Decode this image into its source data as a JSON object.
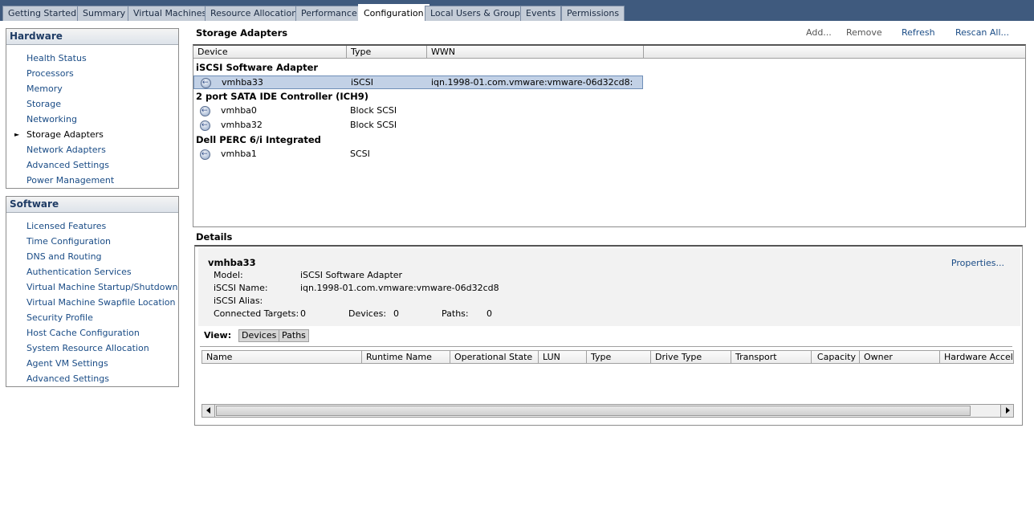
{
  "tabs": [
    {
      "label": "Getting Started"
    },
    {
      "label": "Summary"
    },
    {
      "label": "Virtual Machines"
    },
    {
      "label": "Resource Allocation"
    },
    {
      "label": "Performance"
    },
    {
      "label": "Configuration"
    },
    {
      "label": "Local Users & Groups"
    },
    {
      "label": "Events"
    },
    {
      "label": "Permissions"
    }
  ],
  "hardware": {
    "title": "Hardware",
    "items": [
      {
        "label": "Health Status"
      },
      {
        "label": "Processors"
      },
      {
        "label": "Memory"
      },
      {
        "label": "Storage"
      },
      {
        "label": "Networking"
      },
      {
        "label": "Storage Adapters"
      },
      {
        "label": "Network Adapters"
      },
      {
        "label": "Advanced Settings"
      },
      {
        "label": "Power Management"
      }
    ]
  },
  "software": {
    "title": "Software",
    "items": [
      {
        "label": "Licensed Features"
      },
      {
        "label": "Time Configuration"
      },
      {
        "label": "DNS and Routing"
      },
      {
        "label": "Authentication Services"
      },
      {
        "label": "Virtual Machine Startup/Shutdown"
      },
      {
        "label": "Virtual Machine Swapfile Location"
      },
      {
        "label": "Security Profile"
      },
      {
        "label": "Host Cache Configuration"
      },
      {
        "label": "System Resource Allocation"
      },
      {
        "label": "Agent VM Settings"
      },
      {
        "label": "Advanced Settings"
      }
    ]
  },
  "storage_adapters": {
    "title": "Storage Adapters",
    "actions": {
      "add": "Add...",
      "remove": "Remove",
      "refresh": "Refresh",
      "rescan": "Rescan All..."
    },
    "columns": {
      "device": "Device",
      "type": "Type",
      "wwn": "WWN"
    },
    "groups": [
      {
        "name": "iSCSI Software Adapter",
        "rows": [
          {
            "device": "vmhba33",
            "type": "iSCSI",
            "wwn": "iqn.1998-01.com.vmware:vmware-06d32cd8:"
          }
        ]
      },
      {
        "name": "2 port SATA IDE Controller (ICH9)",
        "rows": [
          {
            "device": "vmhba0",
            "type": "Block SCSI",
            "wwn": ""
          },
          {
            "device": "vmhba32",
            "type": "Block SCSI",
            "wwn": ""
          }
        ]
      },
      {
        "name": "Dell PERC 6/i Integrated",
        "rows": [
          {
            "device": "vmhba1",
            "type": "SCSI",
            "wwn": ""
          }
        ]
      }
    ]
  },
  "details": {
    "title": "Details",
    "name": "vmhba33",
    "properties_link": "Properties...",
    "model_label": "Model:",
    "model_value": "iSCSI Software Adapter",
    "iscsi_name_label": "iSCSI Name:",
    "iscsi_name_value": "iqn.1998-01.com.vmware:vmware-06d32cd8",
    "iscsi_alias_label": "iSCSI Alias:",
    "iscsi_alias_value": "",
    "connected_targets_label": "Connected Targets:",
    "connected_targets_value": "0",
    "devices_label": "Devices:",
    "devices_value": "0",
    "paths_label": "Paths:",
    "paths_value": "0",
    "view_label": "View:",
    "view_devices": "Devices",
    "view_paths": "Paths",
    "columns": [
      "Name",
      "Runtime Name",
      "Operational State",
      "LUN",
      "Type",
      "Drive Type",
      "Transport",
      "Capacity",
      "Owner",
      "Hardware Acceler"
    ]
  }
}
